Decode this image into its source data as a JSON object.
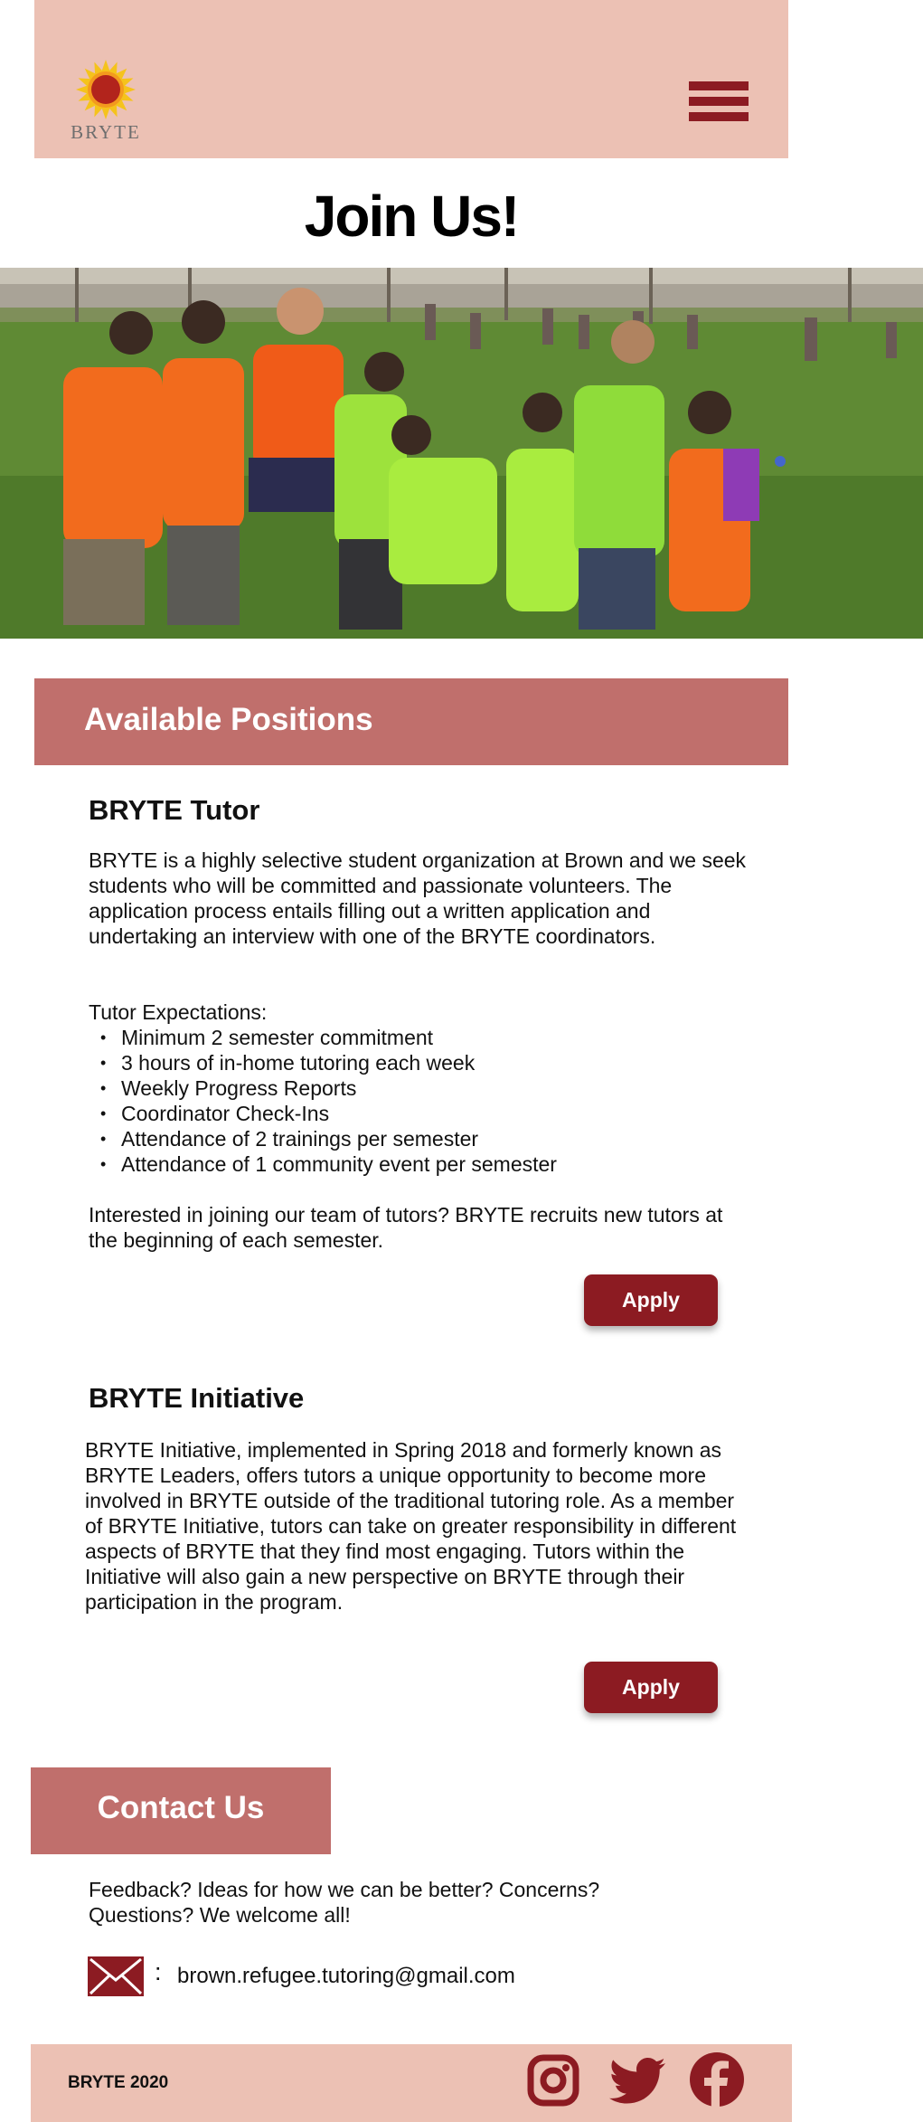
{
  "header": {
    "logo_text": "BRYTE",
    "colors": {
      "header_bg": "#ecc1b4",
      "accent": "#8c1b22",
      "section_bar": "#c06f6c"
    },
    "icons": {
      "logo": "sunflower-logo-icon",
      "menu": "hamburger-menu-icon"
    }
  },
  "page": {
    "title": "Join Us!",
    "hero_image": "group-photo-children-and-tutor-on-lawn"
  },
  "positions": {
    "heading": "Available Positions",
    "tutor": {
      "title": "BRYTE Tutor",
      "intro": "BRYTE is a highly selective student organization at Brown and we seek students who will be committed and passionate volunteers. The application process entails filling out a written application and undertaking an interview with one of the BRYTE coordinators.",
      "expectations_label": "Tutor Expectations:",
      "expectations": [
        "Minimum 2 semester commitment",
        "3 hours of in-home tutoring each week",
        "Weekly Progress Reports",
        "Coordinator Check-Ins",
        "Attendance of 2 trainings per semester",
        "Attendance of 1 community event per semester"
      ],
      "closing": "Interested in joining our team of tutors? BRYTE recruits new tutors at the beginning of each semester.",
      "apply_label": "Apply"
    },
    "initiative": {
      "title": "BRYTE Initiative",
      "description": "BRYTE Initiative, implemented in Spring 2018 and formerly known as BRYTE Leaders, offers tutors a unique opportunity to become more involved in BRYTE outside of the traditional tutoring role. As a member of BRYTE Initiative, tutors can take on greater responsibility in different aspects of BRYTE that they find most engaging. Tutors within the Initiative will also gain a new perspective on BRYTE through their participation in the program.",
      "apply_label": "Apply"
    }
  },
  "contact": {
    "heading": "Contact Us",
    "message": "Feedback? Ideas for how we can be better? Concerns? Questions? We welcome all!",
    "email_colon": ":",
    "email": "brown.refugee.tutoring@gmail.com",
    "icons": {
      "mail": "mail-icon"
    }
  },
  "footer": {
    "text": "BRYTE 2020",
    "social_icons": [
      "instagram-icon",
      "twitter-icon",
      "facebook-icon"
    ]
  }
}
